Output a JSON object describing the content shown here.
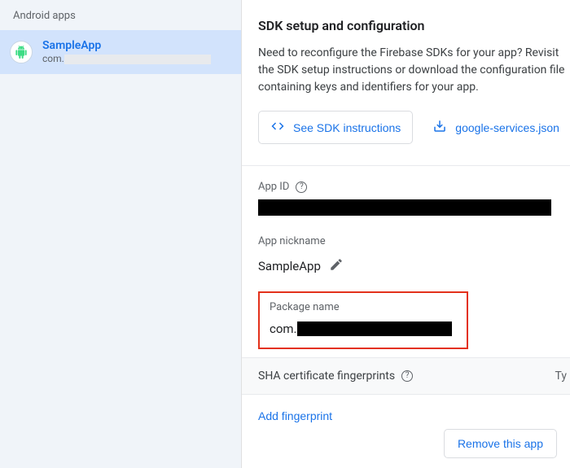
{
  "sidebar": {
    "header": "Android apps",
    "app": {
      "name": "SampleApp",
      "package_prefix": "com."
    }
  },
  "main": {
    "title": "SDK setup and configuration",
    "description": "Need to reconfigure the Firebase SDKs for your app? Revisit the SDK setup instructions or download the configuration file containing keys and identifiers for your app.",
    "buttons": {
      "sdk_instructions": "See SDK instructions",
      "download_config": "google-services.json"
    },
    "fields": {
      "app_id_label": "App ID",
      "nickname_label": "App nickname",
      "nickname_value": "SampleApp",
      "package_label": "Package name",
      "package_prefix": "com."
    },
    "sha": {
      "label": "SHA certificate fingerprints",
      "type_col": "Ty",
      "add_label": "Add fingerprint"
    },
    "footer": {
      "remove_label": "Remove this app"
    }
  },
  "colors": {
    "accent": "#1a73e8",
    "highlight": "#e3311b"
  }
}
